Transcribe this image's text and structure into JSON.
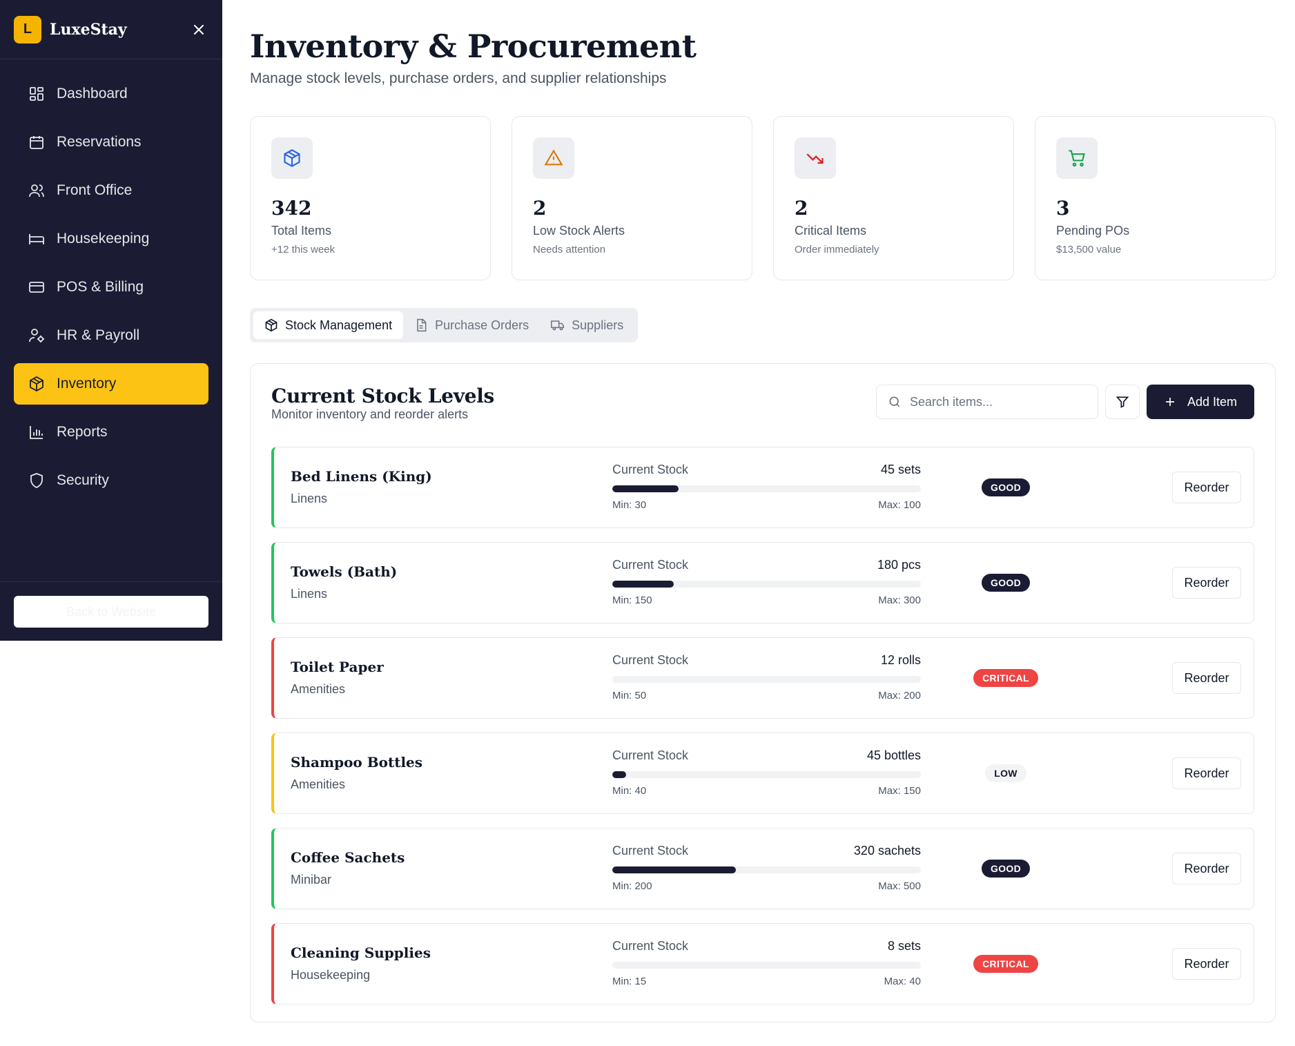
{
  "brand": {
    "logo_letter": "L",
    "name": "LuxeStay"
  },
  "sidebar": {
    "items": [
      {
        "label": "Dashboard",
        "icon": "dashboard-icon",
        "active": false
      },
      {
        "label": "Reservations",
        "icon": "calendar-icon",
        "active": false
      },
      {
        "label": "Front Office",
        "icon": "users-icon",
        "active": false
      },
      {
        "label": "Housekeeping",
        "icon": "bed-icon",
        "active": false
      },
      {
        "label": "POS & Billing",
        "icon": "credit-card-icon",
        "active": false
      },
      {
        "label": "HR & Payroll",
        "icon": "user-cog-icon",
        "active": false
      },
      {
        "label": "Inventory",
        "icon": "package-icon",
        "active": true
      },
      {
        "label": "Reports",
        "icon": "bar-chart-icon",
        "active": false
      },
      {
        "label": "Security",
        "icon": "shield-icon",
        "active": false
      }
    ],
    "back_label": "Back to Website"
  },
  "header": {
    "title": "Inventory & Procurement",
    "subtitle": "Manage stock levels, purchase orders, and supplier relationships"
  },
  "stats": [
    {
      "value": "342",
      "label": "Total Items",
      "note": "+12 this week",
      "icon": "package-icon",
      "color": "#2563eb"
    },
    {
      "value": "2",
      "label": "Low Stock Alerts",
      "note": "Needs attention",
      "icon": "alert-triangle-icon",
      "color": "#d97706"
    },
    {
      "value": "2",
      "label": "Critical Items",
      "note": "Order immediately",
      "icon": "trending-down-icon",
      "color": "#dc2626"
    },
    {
      "value": "3",
      "label": "Pending POs",
      "note": "$13,500 value",
      "icon": "shopping-cart-icon",
      "color": "#16a34a"
    }
  ],
  "tabs": [
    {
      "label": "Stock Management",
      "icon": "package-icon",
      "active": true
    },
    {
      "label": "Purchase Orders",
      "icon": "file-icon",
      "active": false
    },
    {
      "label": "Suppliers",
      "icon": "truck-icon",
      "active": false
    }
  ],
  "panel": {
    "title": "Current Stock Levels",
    "subtitle": "Monitor inventory and reorder alerts",
    "search_placeholder": "Search items...",
    "add_label": "Add Item",
    "stock_label": "Current Stock",
    "reorder_label": "Reorder"
  },
  "items": [
    {
      "name": "Bed Linens (King)",
      "category": "Linens",
      "qty": "45 sets",
      "min": "Min: 30",
      "max": "Max: 100",
      "fill": 0.214,
      "status": "GOOD",
      "level": "good"
    },
    {
      "name": "Towels (Bath)",
      "category": "Linens",
      "qty": "180 pcs",
      "min": "Min: 150",
      "max": "Max: 300",
      "fill": 0.2,
      "status": "GOOD",
      "level": "good"
    },
    {
      "name": "Toilet Paper",
      "category": "Amenities",
      "qty": "12 rolls",
      "min": "Min: 50",
      "max": "Max: 200",
      "fill": 0,
      "status": "CRITICAL",
      "level": "critical"
    },
    {
      "name": "Shampoo Bottles",
      "category": "Amenities",
      "qty": "45 bottles",
      "min": "Min: 40",
      "max": "Max: 150",
      "fill": 0.045,
      "status": "LOW",
      "level": "low"
    },
    {
      "name": "Coffee Sachets",
      "category": "Minibar",
      "qty": "320 sachets",
      "min": "Min: 200",
      "max": "Max: 500",
      "fill": 0.4,
      "status": "GOOD",
      "level": "good"
    },
    {
      "name": "Cleaning Supplies",
      "category": "Housekeeping",
      "qty": "8 sets",
      "min": "Min: 15",
      "max": "Max: 40",
      "fill": 0,
      "status": "CRITICAL",
      "level": "critical"
    }
  ]
}
